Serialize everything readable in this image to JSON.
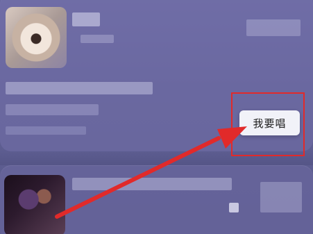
{
  "action": {
    "sing_button_label": "我要唱"
  },
  "colors": {
    "background": "#5f5f93",
    "card": "#7370aa",
    "button_bg": "#f1f2f8",
    "highlight": "#e12a2a"
  },
  "icons": {
    "annotation_arrow": "arrow-icon"
  }
}
